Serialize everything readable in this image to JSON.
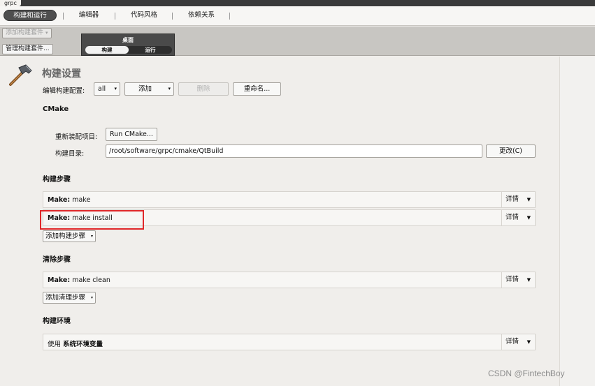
{
  "project_tab": "grpc",
  "mode_tabs": [
    {
      "label": "构建和运行",
      "active": true
    },
    {
      "label": "编辑器",
      "active": false
    },
    {
      "label": "代码风格",
      "active": false
    },
    {
      "label": "依赖关系",
      "active": false
    }
  ],
  "kits": {
    "add_kit_label": "添加构建套件",
    "manage_kits_label": "管理构建套件...",
    "kit_name": "桌面",
    "build_label": "构建",
    "run_label": "运行",
    "selected": "构建"
  },
  "build_settings": {
    "title": "构建设置",
    "edit_config_label": "编辑构建配置:",
    "config_value": "all",
    "add_label": "添加",
    "delete_label": "删除",
    "rename_label": "重命名..."
  },
  "cmake": {
    "section_title": "CMake",
    "reconfigure_label": "重新装配项目:",
    "run_cmake_label": "Run CMake...",
    "build_dir_label": "构建目录:",
    "build_dir_value": "/root/software/grpc/cmake/QtBuild",
    "change_label": "更改(C)"
  },
  "build_steps": {
    "section_title": "构建步骤",
    "steps": [
      {
        "prefix": "Make:",
        "command": "make",
        "details": "详情"
      },
      {
        "prefix": "Make:",
        "command": "make install",
        "details": "详情"
      }
    ],
    "add_label": "添加构建步骤"
  },
  "clean_steps": {
    "section_title": "清除步骤",
    "steps": [
      {
        "prefix": "Make:",
        "command": "make clean",
        "details": "详情"
      }
    ],
    "add_label": "添加清理步骤"
  },
  "build_env": {
    "section_title": "构建环境",
    "use_label": "使用",
    "env_name": "系统环境变量",
    "details": "详情"
  },
  "watermark": "CSDN @FintechBoy",
  "colors": {
    "highlight": "#e0282a",
    "active_tab": "#4e4e4e"
  }
}
